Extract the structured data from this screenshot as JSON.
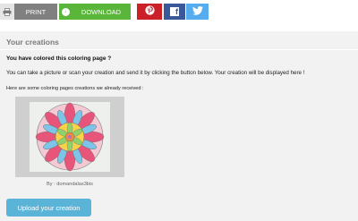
{
  "toolbar": {
    "print_label": "PRINT",
    "download_label": "DOWNLOAD",
    "facebook_glyph": "f"
  },
  "section": {
    "title": "Your creations",
    "question": "You have colored this coloring page ?",
    "description": "You can take a picture or scan your creation and send it by clicking the button below. Your creation will be displayed here !",
    "received_intro": "Here are some coloring pages creations we already received :",
    "creation_caption": "By : domandalas3bis",
    "upload_label": "Upload your creation"
  },
  "icons": {
    "print": "printer-icon",
    "download": "download-icon",
    "pinterest": "pinterest-icon",
    "facebook": "facebook-icon",
    "twitter": "twitter-icon"
  },
  "colors": {
    "print_bg": "#808080",
    "download_bg": "#59b63a",
    "pinterest_bg": "#cb2027",
    "facebook_bg": "#3b5998",
    "twitter_bg": "#55acee",
    "upload_bg": "#5ab4d8",
    "panel_bg": "#f2f2f2"
  }
}
